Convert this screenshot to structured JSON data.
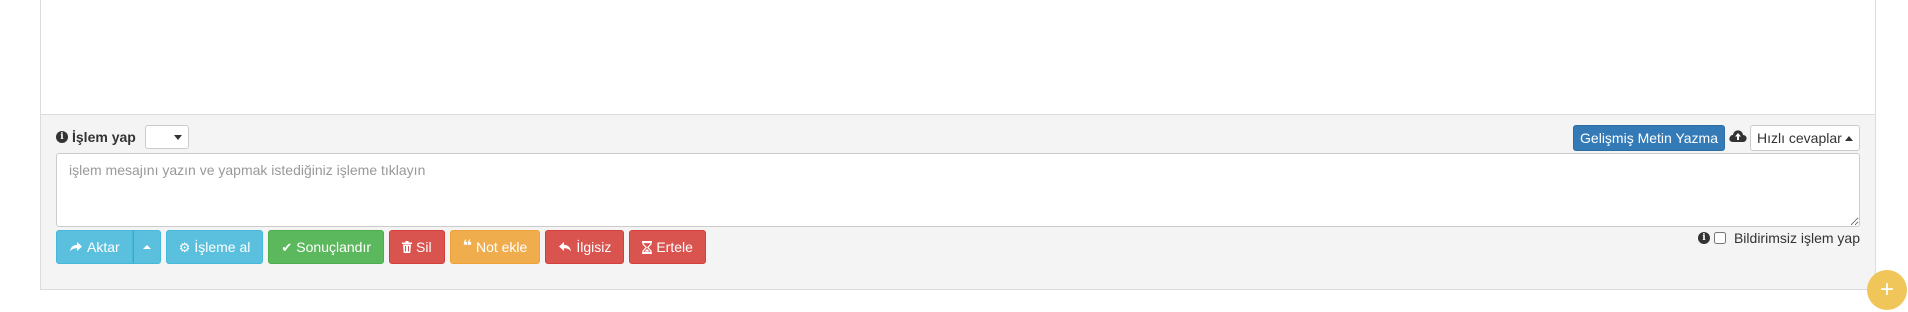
{
  "action": {
    "label": "İşlem yap",
    "select_value": ""
  },
  "toolbar": {
    "advanced_label": "Gelişmiş Metin Yazma",
    "quick_replies_label": "Hızlı cevaplar"
  },
  "message": {
    "placeholder": "işlem mesajını yazın ve yapmak istediğiniz işleme tıklayın",
    "value": ""
  },
  "buttons": {
    "aktar": "Aktar",
    "isleme_al": "İşleme al",
    "sonuclandir": "Sonuçlandır",
    "sil": "Sil",
    "not_ekle": "Not ekle",
    "ilgisiz": "İlgisiz",
    "ertele": "Ertele"
  },
  "silent": {
    "label": "Bildirimsiz işlem yap",
    "checked": false
  },
  "fab": {
    "symbol": "+"
  },
  "colors": {
    "primary": "#337ab7",
    "info": "#5bc0de",
    "success": "#5cb85c",
    "danger": "#d9534f",
    "warning": "#f0ad4e",
    "fab": "#f0c65a"
  },
  "icons": {
    "info": "info-circle-icon",
    "cloud": "cloud-upload-icon",
    "share": "share-icon",
    "gear": "gear-icon",
    "check": "check-icon",
    "trash": "trash-icon",
    "quote": "quote-icon",
    "reply": "reply-icon",
    "hourglass": "hourglass-icon"
  }
}
